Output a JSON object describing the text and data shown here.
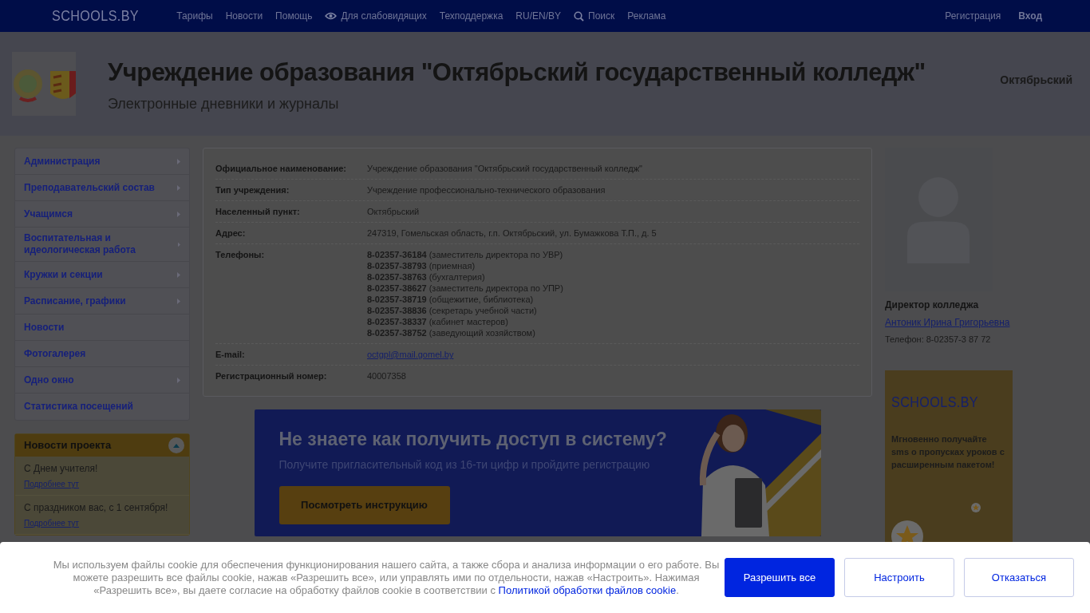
{
  "topbar": {
    "logo": "SCHOOLS.BY",
    "links": [
      {
        "label": "Тарифы",
        "kind": "text"
      },
      {
        "label": "Новости",
        "kind": "text"
      },
      {
        "label": "Помощь",
        "kind": "text"
      },
      {
        "label": "Для слабовидящих",
        "kind": "eye"
      },
      {
        "label": "Техподдержка",
        "kind": "text"
      },
      {
        "label": "RU/EN/BY",
        "kind": "text"
      },
      {
        "label": "Поиск",
        "kind": "search"
      },
      {
        "label": "Реклама",
        "kind": "text"
      }
    ],
    "account": [
      {
        "label": "Регистрация",
        "bold": false
      },
      {
        "label": "Вход",
        "bold": true
      }
    ]
  },
  "header": {
    "title": "Учреждение образования \"Октябрьский государственный колледж\"",
    "subtitle": "Электронные дневники и журналы",
    "city": "Октябрьский"
  },
  "sidebar": {
    "items": [
      {
        "label": "Администрация",
        "has_submenu": true
      },
      {
        "label": "Преподавательский состав",
        "has_submenu": true
      },
      {
        "label": "Учащимся",
        "has_submenu": true
      },
      {
        "label": "Воспитательная и идеологическая работа",
        "has_submenu": true
      },
      {
        "label": "Кружки и секции",
        "has_submenu": true
      },
      {
        "label": "Расписание, графики",
        "has_submenu": true
      },
      {
        "label": "Новости",
        "has_submenu": false
      },
      {
        "label": "Фотогалерея",
        "has_submenu": false
      },
      {
        "label": "Одно окно",
        "has_submenu": true
      },
      {
        "label": "Статистика посещений",
        "has_submenu": false
      }
    ],
    "news": {
      "title": "Новости проекта",
      "expanded": true,
      "items": [
        {
          "title": "С Днем учителя!",
          "link": "Подробнее тут"
        },
        {
          "title": "С праздником вас, с 1 сентября!",
          "link": "Подробнее тут"
        }
      ]
    }
  },
  "info": {
    "rows": [
      {
        "kind": "text",
        "label": "Официальное наименование:",
        "value": "Учреждение образования \"Октябрьский государственный колледж\""
      },
      {
        "kind": "text",
        "label": "Тип учреждения:",
        "value": "Учреждение профессионально-технического образования"
      },
      {
        "kind": "text",
        "label": "Населенный пункт:",
        "value": "Октябрьский"
      },
      {
        "kind": "text",
        "label": "Адрес:",
        "value": "247319, Гомельская область, г.п. Октябрьский, ул. Бумажкова Т.П., д. 5"
      },
      {
        "kind": "phones",
        "label": "Телефоны:",
        "phones": [
          {
            "number": "8-02357-36184",
            "note": "(заместитель директора по УВР)"
          },
          {
            "number": "8-02357-38793",
            "note": "(приемная)"
          },
          {
            "number": "8-02357-38763",
            "note": "(бухгалтерия)"
          },
          {
            "number": "8-02357-38627",
            "note": "(заместитель директора по УПР)"
          },
          {
            "number": "8-02357-38719",
            "note": "(общежитие, библиотека)"
          },
          {
            "number": "8-02357-38836",
            "note": "(секретарь учебной части)"
          },
          {
            "number": "8-02357-38337",
            "note": "(кабинет мастеров)"
          },
          {
            "number": "8-02357-38752",
            "note": "(заведующий хозяйством)"
          }
        ]
      },
      {
        "kind": "link",
        "label": "E-mail:",
        "value": "octgpl@mail.gomel.by"
      },
      {
        "kind": "text",
        "label": "Регистрационный номер:",
        "value": "40007358"
      }
    ]
  },
  "banner": {
    "heading": "Не знаете как получить доступ в систему?",
    "subheading": "Получите пригласительный код из 16-ти цифр и пройдите регистрацию",
    "button": "Посмотреть инструкцию"
  },
  "director": {
    "role": "Директор колледжа",
    "name": "Антоник Ирина Григорьевна",
    "phone": "Телефон: 8-02357-3 87 72"
  },
  "ad": {
    "logo": "SCHOOLS.BY",
    "text": "Мгновенно получайте sms о пропусках уроков с расширенным пакетом!"
  },
  "cookie": {
    "text": "Мы используем файлы cookie для обеспечения функционирования нашего сайта, а также сбора и анализа информации о его работе. Вы можете разрешить все файлы cookie, нажав «Разрешить все», или управлять ими по отдельности, нажав «Настроить». Нажимая «Разрешить все», вы даете согласие на обработку файлов cookie в соответствии с",
    "link": "Политикой обработки файлов cookie",
    "end": ".",
    "buttons": [
      {
        "label": "Разрешить все",
        "primary": true
      },
      {
        "label": "Настроить",
        "primary": false
      },
      {
        "label": "Отказаться",
        "primary": false
      }
    ]
  }
}
